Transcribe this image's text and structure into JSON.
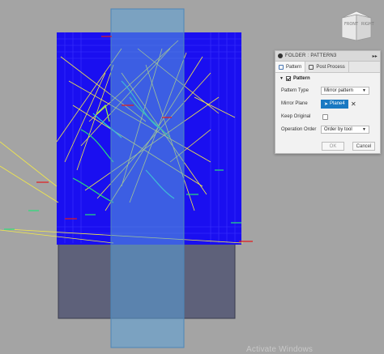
{
  "dialog": {
    "breadcrumb_root": "FOLDER",
    "breadcrumb_leaf": "PATTERN3",
    "close_glyph": "▸▸",
    "tabs": [
      {
        "label": "Pattern",
        "icon": "pattern-tab-icon"
      },
      {
        "label": "Post Process",
        "icon": "post-process-tab-icon"
      }
    ],
    "section_label": "Pattern",
    "fields": {
      "pattern_type": {
        "label": "Pattern Type",
        "value": "Mirror pattern"
      },
      "mirror_plane": {
        "label": "Mirror Plane",
        "value": "Plane4"
      },
      "keep_original": {
        "label": "Keep Original",
        "checked": false
      },
      "operation_order": {
        "label": "Operation Order",
        "value": "Order by tool"
      }
    },
    "ok_label": "OK",
    "cancel_label": "Cancel"
  },
  "viewcube": {
    "front": "FRONT",
    "right": "RIGHT"
  },
  "watermark": "Activate Windows",
  "colors": {
    "background": "#a4a4a4",
    "toolpath_blue": "#1200ff",
    "plane_overlay": "#5aa0d8",
    "rapid_yellow": "#f2e94a",
    "accent_button": "#1a79c2"
  }
}
